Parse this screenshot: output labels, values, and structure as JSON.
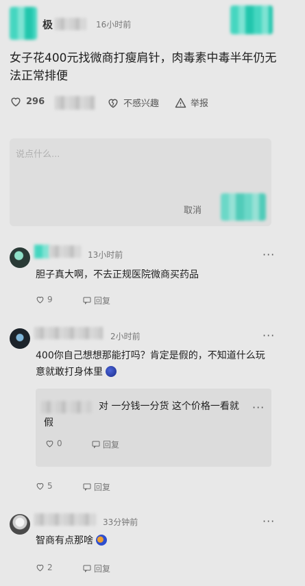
{
  "post": {
    "author_initial": "极",
    "time": "16小时前",
    "title": "女子花400元找微商打瘦肩针，肉毒素中毒半年仍无法正常排便",
    "likes": "296",
    "not_interested": "不感兴趣",
    "report": "举报"
  },
  "comment_input": {
    "placeholder": "说点什么...",
    "cancel": "取消"
  },
  "comments": [
    {
      "time": "13小时前",
      "text": "胆子真大啊，不去正规医院微商买药品",
      "likes": "9",
      "reply_label": "回复"
    },
    {
      "time": "2小时前",
      "text": "400你自己想想那能打吗？肯定是假的，不知道什么玩意就敢打身体里",
      "likes": "5",
      "reply_label": "回复",
      "reply": {
        "text": "对 一分钱一分货 这个价格一看就假",
        "likes": "0",
        "reply_label": "回复"
      }
    },
    {
      "time": "33分钟前",
      "text": "智商有点那啥",
      "likes": "2",
      "reply_label": "回复"
    }
  ],
  "colors": {
    "accent": "#2ec8b0",
    "background": "#e8e8e8",
    "card": "#dedede"
  }
}
